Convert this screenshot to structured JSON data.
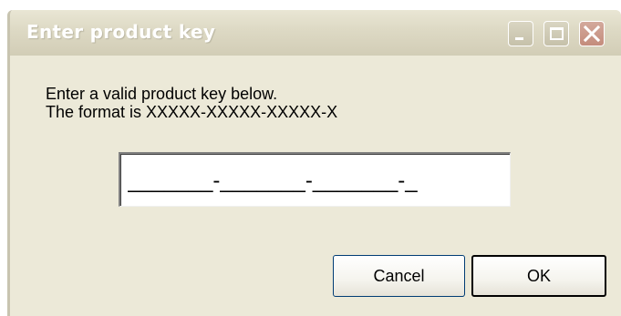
{
  "window": {
    "title": "Enter product key",
    "buttons": {
      "minimize": "minimize-icon",
      "maximize": "maximize-icon",
      "close": "close-icon"
    }
  },
  "prompt": {
    "line1": "Enter a valid product key below.",
    "line2": "The format is XXXXX-XXXXX-XXXXX-X"
  },
  "product_key": {
    "value": "_______-_______-_______-_"
  },
  "actions": {
    "cancel_label": "Cancel",
    "ok_label": "OK"
  },
  "colors": {
    "window_bg": "#ece9d8",
    "title_text": "#ffffff",
    "close_button": "#c48c7c",
    "button_border": "#003c74"
  }
}
